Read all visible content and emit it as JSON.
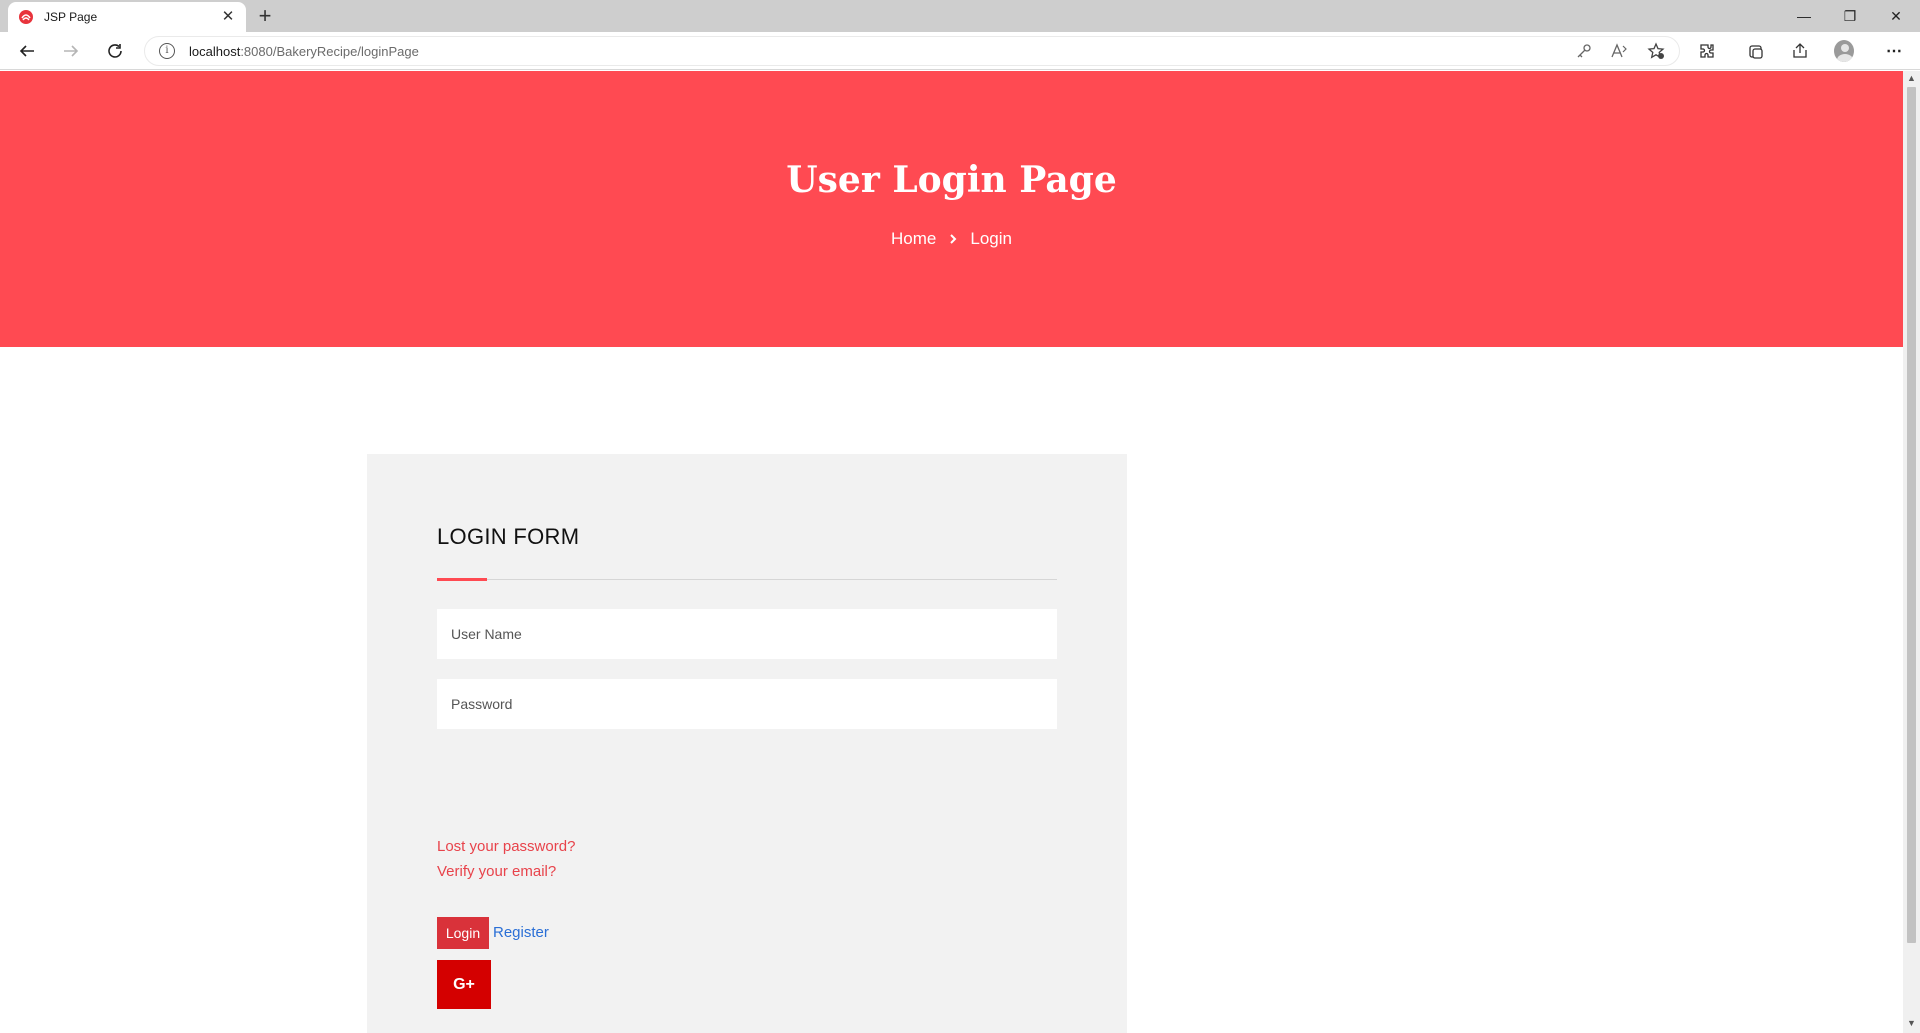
{
  "browser": {
    "tab_title": "JSP Page",
    "tab_close": "✕",
    "new_tab": "+",
    "url_host": "localhost",
    "url_path": ":8080/BakeryRecipe/loginPage",
    "url_info": "i",
    "more": "⋯",
    "window": {
      "minimize": "—",
      "restore": "❐",
      "close": "✕"
    }
  },
  "hero": {
    "title": "User Login Page",
    "breadcrumb": {
      "home": "Home",
      "current": "Login"
    },
    "bg_color": "#ff4a52"
  },
  "login_form": {
    "title": "LOGIN FORM",
    "username_placeholder": "User Name",
    "password_placeholder": "Password",
    "lost_password": "Lost your password?",
    "verify_email": "Verify your email?",
    "login_button": "Login",
    "register_link": "Register",
    "google_button": "G+",
    "accent_color": "#ff4a52",
    "google_color": "#d40000"
  },
  "scrollbar": {
    "up": "▲",
    "down": "▼"
  }
}
